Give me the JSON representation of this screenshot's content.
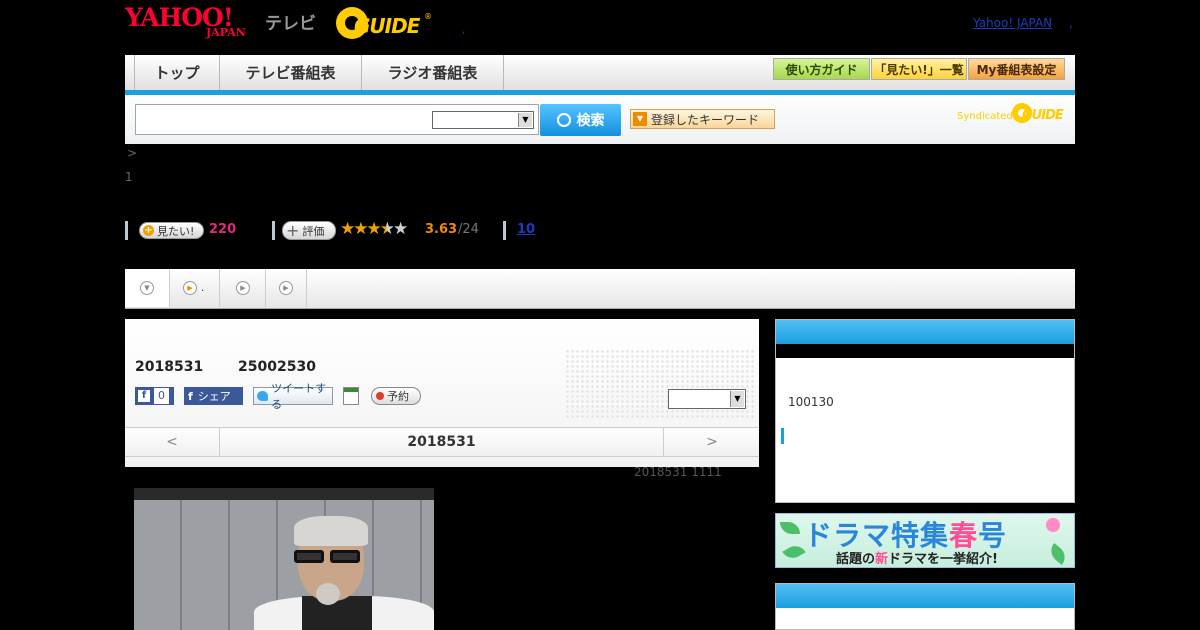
{
  "header": {
    "logo_yahoo": "YAHOO!",
    "logo_japan": "JAPAN",
    "logo_tv": "テレビ",
    "logo_guide": "GUIDE",
    "logo_reg": "®",
    "dot_link": ",",
    "yahoo_japan_link": "Yahoo! JAPAN",
    "yahoo_japan_sep": ","
  },
  "nav": {
    "tabs": [
      "トップ",
      "テレビ番組表",
      "ラジオ番組表"
    ],
    "buttons": [
      "使い方ガイド",
      "「見たい!」一覧",
      "My番組表設定"
    ],
    "button_colors": [
      "#a6d94a",
      "#ffd23a",
      "#f7a23a"
    ]
  },
  "search": {
    "button_label": "検索",
    "keyword_label": "登録したキーワード",
    "syndicated": "Syndicated",
    "syndicated_guide": "GUIDE"
  },
  "breadcrumb": ">",
  "page_number": "1",
  "stats": {
    "want_label": "見たい!",
    "want_count": "220",
    "rate_label": "評価",
    "stars_filled": "★★★",
    "stars_half": "★",
    "stars_empty": "★",
    "score": "3.63",
    "score_count": "/24",
    "reviews": "10"
  },
  "tabs": {
    "dot_label": "."
  },
  "program": {
    "date": "2018531",
    "time": "25002530",
    "fb_icon": "f",
    "fb_count": "0",
    "fb_like_icon": "f",
    "share_label": "シェア",
    "tweet_label": "ツイートする",
    "reserve_label": "予約",
    "prev": "<",
    "nav_date": "2018531",
    "next": ">",
    "updated": "2018531  1111"
  },
  "sidebar": {
    "value": "100130"
  },
  "banner": {
    "title_main": "ドラマ特集",
    "title_haru": "春",
    "title_go": "号",
    "sub_1": "話題の",
    "sub_new": "新",
    "sub_2": "ドラマを一挙紹介!"
  },
  "colors": {
    "accent_blue": "#1a9fe0",
    "brand_red": "#ff0033",
    "guide_yellow": "#ffcc00",
    "link_blue": "#1a3dbd"
  }
}
